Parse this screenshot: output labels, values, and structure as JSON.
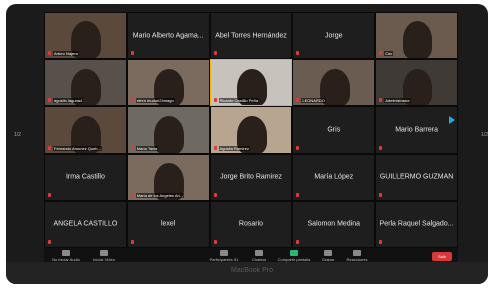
{
  "tiles": [
    {
      "name": "",
      "caption": "Arturo Najera",
      "type": "video"
    },
    {
      "name": "Mario Alberto Agama...",
      "caption": "",
      "type": "name"
    },
    {
      "name": "Abel Torres Hernández",
      "caption": "",
      "type": "name"
    },
    {
      "name": "Jorge",
      "caption": "",
      "type": "name"
    },
    {
      "name": "",
      "caption": "Cec",
      "type": "video"
    },
    {
      "name": "",
      "caption": "agustin laguna4",
      "type": "video"
    },
    {
      "name": "",
      "caption": "efren muduri24mago",
      "type": "video"
    },
    {
      "name": "",
      "caption": "Ricardo Castillo Peña",
      "type": "video"
    },
    {
      "name": "",
      "caption": "LEONARDO",
      "type": "video"
    },
    {
      "name": "",
      "caption": "Administrador",
      "type": "video"
    },
    {
      "name": "",
      "caption": "Fernando Amunez Queb...",
      "type": "video"
    },
    {
      "name": "",
      "caption": "Maria Tania",
      "type": "video"
    },
    {
      "name": "",
      "caption": "Agustin Ramirez",
      "type": "video"
    },
    {
      "name": "Gris",
      "caption": "",
      "type": "name"
    },
    {
      "name": "Mario Barrera",
      "caption": "",
      "type": "name"
    },
    {
      "name": "Irma Castillo",
      "caption": "",
      "type": "name"
    },
    {
      "name": "",
      "caption": "Maria de los Angeles Ari...",
      "type": "video"
    },
    {
      "name": "Jorge Brito Ramirez",
      "caption": "",
      "type": "name"
    },
    {
      "name": "María López",
      "caption": "",
      "type": "name"
    },
    {
      "name": "GUILLERMO GUZMAN",
      "caption": "",
      "type": "name"
    },
    {
      "name": "ANGELA CASTILLO",
      "caption": "",
      "type": "name"
    },
    {
      "name": "lexel",
      "caption": "",
      "type": "name"
    },
    {
      "name": "Rosario",
      "caption": "",
      "type": "name"
    },
    {
      "name": "Salomon  Medina",
      "caption": "",
      "type": "name"
    },
    {
      "name": "Perla Raquel Salgado...",
      "caption": "",
      "type": "name"
    }
  ],
  "page": {
    "left": "1/2",
    "right": "1/2"
  },
  "toolbar": {
    "audio": "No iniciar Audio",
    "video": "Iniciar Video",
    "participants": "Participantes",
    "participants_count": "51",
    "chat": "Chatear",
    "share": "Compartir pantalla",
    "record": "Grabar",
    "reactions": "Reacciones",
    "end": "Salir"
  },
  "brand": "MacBook Pro",
  "colors": {
    "end": "#d83838",
    "speaker_border": "#f2b600",
    "share": "#2bb673"
  }
}
